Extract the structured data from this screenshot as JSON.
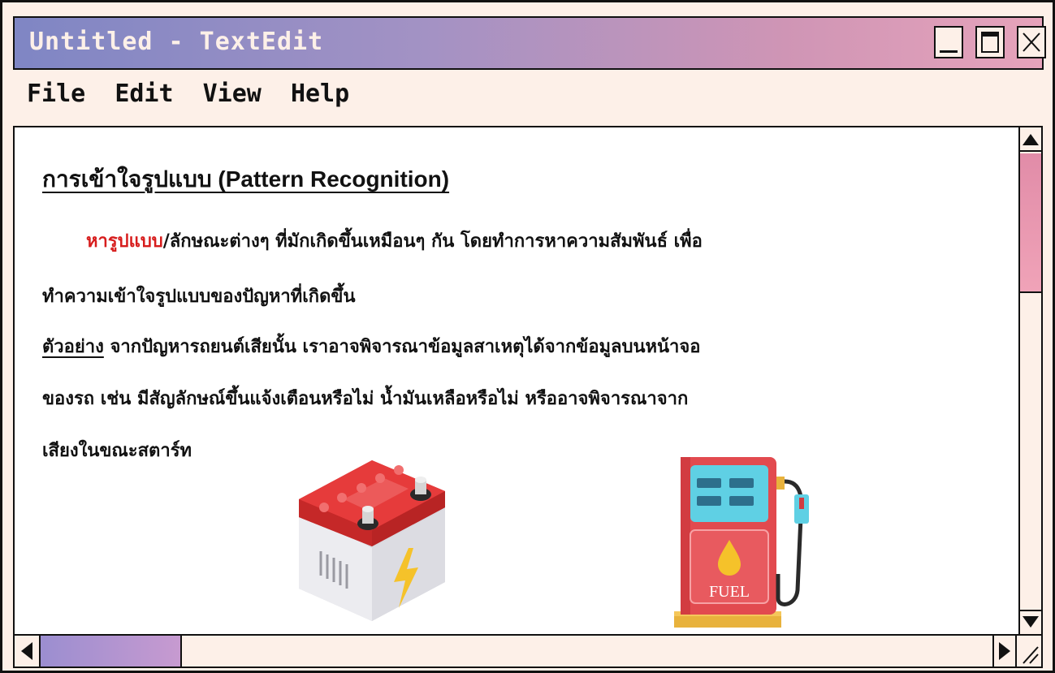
{
  "window": {
    "title": "Untitled - TextEdit",
    "controls": {
      "minimize": "minimize",
      "maximize": "maximize",
      "close": "close"
    }
  },
  "menu": {
    "items": [
      "File",
      "Edit",
      "View",
      "Help"
    ]
  },
  "document": {
    "heading": "การเข้าใจรูปแบบ (Pattern Recognition)",
    "p1_highlight": "หารูปแบบ",
    "p1_rest": "/ลักษณะต่างๆ ที่มักเกิดขึ้นเหมือนๆ กัน โดยทำการหาความสัมพันธ์ เพื่อ",
    "p2": "ทำความเข้าใจรูปแบบของปัญหาที่เกิดขึ้น",
    "example_label": "ตัวอย่าง",
    "p3_rest": " จากปัญหารถยนต์เสียนั้น เราอาจพิจารณาข้อมูลสาเหตุได้จากข้อมูลบนหน้าจอ",
    "p4": "ของรถ เช่น มีสัญลักษณ์ขึ้นแจ้งเตือนหรือไม่ น้ำมันเหลือหรือไม่ หรืออาจพิจารณาจาก",
    "p5": "เสียงในขณะสตาร์ท",
    "fuel_label": "FUEL"
  },
  "colors": {
    "highlight": "#d71d1d",
    "battery_top": "#e63b3b",
    "battery_body": "#e9e9ee",
    "pump_body": "#e24a4f",
    "pump_screen": "#5fd0e4",
    "bolt": "#f5c22a"
  },
  "icons": [
    "battery-icon",
    "fuel-pump-icon",
    "scroll-up-icon",
    "scroll-down-icon",
    "scroll-left-icon",
    "scroll-right-icon",
    "resize-grip-icon"
  ]
}
